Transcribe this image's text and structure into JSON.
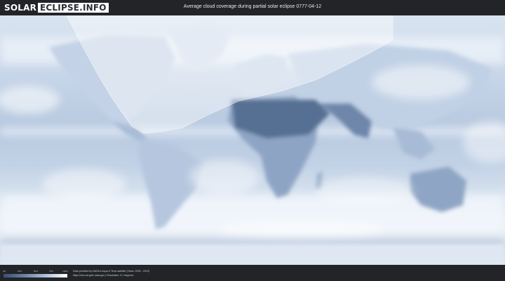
{
  "logo": {
    "part1": "SOLAR",
    "part2": "ECLIPSE.INFO"
  },
  "header": {
    "title": "Average cloud coverage during partial solar eclipse 0777-04-12"
  },
  "legend": {
    "ticks": [
      "0%",
      "25%",
      "50%",
      "75%",
      "100%"
    ]
  },
  "credits": {
    "line1": "Data provided by NASA's Aqua & Terra satellite (Years: 2000 - 2019)",
    "line2": "https://neo.sci.gsfc.nasa.gov | Resolution: 0.1 degrees"
  },
  "colors": {
    "background": "#222428",
    "ocean_clear": "#bfd0e4",
    "cloud": "#f2f6fb",
    "desert_clear": "#536b8f",
    "eclipse_overlay": "#ffffff"
  }
}
